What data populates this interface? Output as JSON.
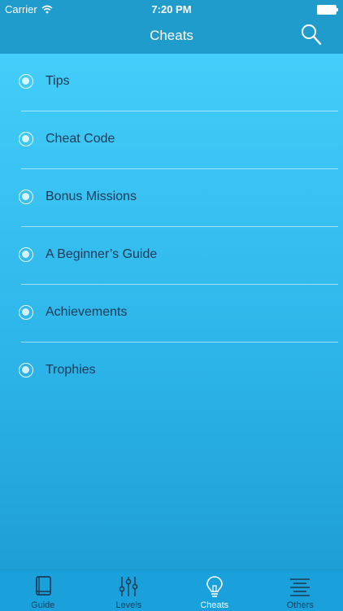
{
  "status_bar": {
    "carrier": "Carrier",
    "time": "7:20 PM"
  },
  "nav": {
    "title": "Cheats",
    "search_icon": "search-icon"
  },
  "items": [
    {
      "label": "Tips"
    },
    {
      "label": "Cheat Code"
    },
    {
      "label": "Bonus Missions"
    },
    {
      "label": "A Beginner’s Guide"
    },
    {
      "label": "Achievements"
    },
    {
      "label": "Trophies"
    }
  ],
  "tabs": [
    {
      "label": "Guide",
      "icon": "book-icon"
    },
    {
      "label": "Levels",
      "icon": "sliders-icon"
    },
    {
      "label": "Cheats",
      "icon": "lightbulb-icon",
      "active": true
    },
    {
      "label": "Others",
      "icon": "menu-lines-icon"
    }
  ],
  "colors": {
    "navbar": "#1f9ccc",
    "content_top": "#43cdf9",
    "content_bottom": "#1e9fd6",
    "text": "#1d3b56",
    "tab_active": "#ffffff"
  }
}
